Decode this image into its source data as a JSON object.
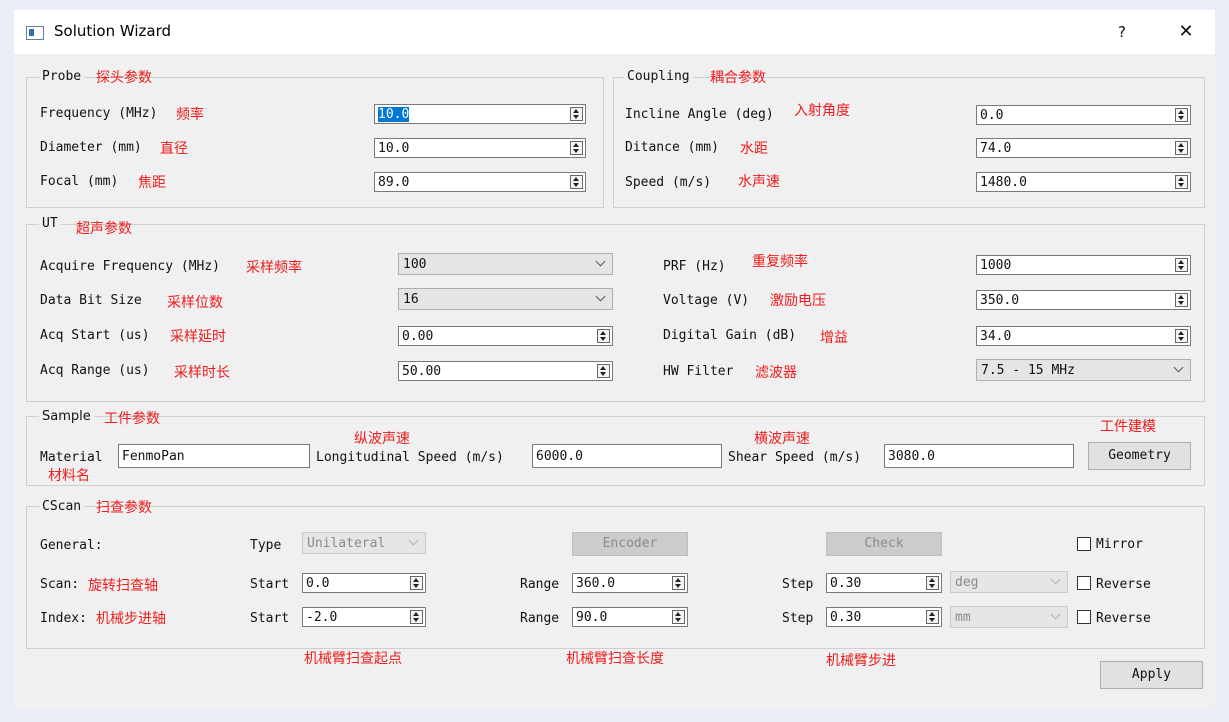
{
  "window": {
    "title": "Solution Wizard",
    "help_label": "?",
    "close_label": "✕"
  },
  "probe": {
    "title": "Probe",
    "note": "探头参数",
    "frequency": {
      "label": "Frequency (MHz)",
      "note": "频率",
      "value": "10.0"
    },
    "diameter": {
      "label": "Diameter (mm)",
      "note": "直径",
      "value": "10.0"
    },
    "focal": {
      "label": "Focal (mm)",
      "note": "焦距",
      "value": "89.0"
    }
  },
  "coupling": {
    "title": "Coupling",
    "note": "耦合参数",
    "incline": {
      "label": "Incline Angle (deg)",
      "note": "入射角度",
      "value": "0.0"
    },
    "distance": {
      "label": "Ditance (mm)",
      "note": "水距",
      "value": "74.0"
    },
    "speed": {
      "label": "Speed (m/s)",
      "note": "水声速",
      "value": "1480.0"
    }
  },
  "ut": {
    "title": "UT",
    "note": "超声参数",
    "acquire_frequency": {
      "label": "Acquire Frequency (MHz)",
      "note": "采样频率",
      "value": "100"
    },
    "data_bit_size": {
      "label": "Data Bit Size",
      "note": "采样位数",
      "value": "16"
    },
    "acq_start": {
      "label": "Acq Start (us)",
      "note": "采样延时",
      "value": "0.00"
    },
    "acq_range": {
      "label": "Acq Range (us)",
      "note": "采样时长",
      "value": "50.00"
    },
    "prf": {
      "label": "PRF (Hz)",
      "note": "重复频率",
      "value": "1000"
    },
    "voltage": {
      "label": "Voltage (V)",
      "note": "激励电压",
      "value": "350.0"
    },
    "digital_gain": {
      "label": "Digital Gain (dB)",
      "note": "增益",
      "value": "34.0"
    },
    "hw_filter": {
      "label": "HW Filter",
      "note": "滤波器",
      "value": "7.5 - 15 MHz"
    }
  },
  "sample": {
    "title": "Sample",
    "note": "工件参数",
    "material": {
      "label": "Material",
      "note": "材料名",
      "value": "FenmoPan"
    },
    "longitudinal": {
      "label": "Longitudinal Speed (m/s)",
      "note": "纵波声速",
      "value": "6000.0"
    },
    "shear": {
      "label": "Shear Speed (m/s)",
      "note": "横波声速",
      "value": "3080.0"
    },
    "geometry": {
      "label": "Geometry",
      "note": "工件建模"
    }
  },
  "cscan": {
    "title": "CScan",
    "note": "扫查参数",
    "general_label": "General:",
    "type_label": "Type",
    "type_value": "Unilateral",
    "encoder_label": "Encoder",
    "check_label": "Check",
    "mirror_label": "Mirror",
    "scan": {
      "label": "Scan:",
      "note": "旋转扫查轴",
      "start_label": "Start",
      "start": "0.0",
      "range_label": "Range",
      "range": "360.0",
      "step_label": "Step",
      "step": "0.30",
      "unit": "deg",
      "reverse_label": "Reverse"
    },
    "index": {
      "label": "Index:",
      "note": "机械步进轴",
      "start_label": "Start",
      "start": "-2.0",
      "range_label": "Range",
      "range": "90.0",
      "step_label": "Step",
      "step": "0.30",
      "unit": "mm",
      "reverse_label": "Reverse"
    },
    "notes": {
      "start": "机械臂扫查起点",
      "range": "机械臂扫查长度",
      "step": "机械臂步进"
    }
  },
  "apply_label": "Apply"
}
